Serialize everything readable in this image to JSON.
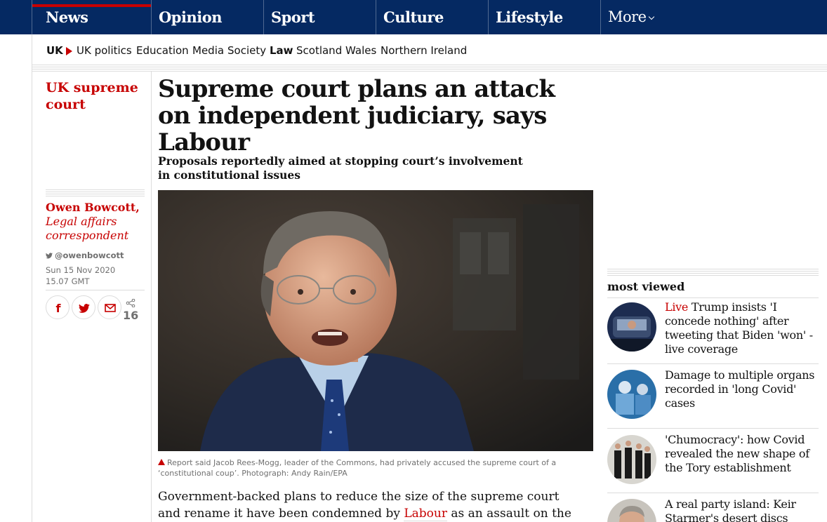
{
  "nav": {
    "pillars": [
      {
        "label": "News"
      },
      {
        "label": "Opinion"
      },
      {
        "label": "Sport"
      },
      {
        "label": "Culture"
      },
      {
        "label": "Lifestyle"
      }
    ],
    "more_label": "More"
  },
  "subnav": {
    "section": "UK",
    "items": [
      "UK politics",
      "Education",
      "Media",
      "Society",
      "Law",
      "Scotland",
      "Wales",
      "Northern Ireland"
    ],
    "active": "Law"
  },
  "series": "UK supreme court",
  "byline": {
    "name": "Owen Bowcott,",
    "role": "Legal affairs correspondent",
    "twitter": "@owenbowcott",
    "date": "Sun 15 Nov 2020",
    "time": "15.07 GMT"
  },
  "share": {
    "count": "16",
    "icons": [
      "facebook-icon",
      "twitter-icon",
      "email-icon",
      "share-icon"
    ]
  },
  "article": {
    "headline": "Supreme court plans an attack on independent judiciary, says Labour",
    "standfirst": "Proposals reportedly aimed at stopping court’s involvement in constitutional issues",
    "caption": "Report said Jacob Rees-Mogg, leader of the Commons, had privately accused the supreme court of a ‘constitutional coup’. Photograph: Andy Rain/EPA",
    "body_before": "Government-backed plans to reduce the size of the supreme court and rename it have been condemned by ",
    "body_link": "Labour",
    "body_after": " as an assault on the"
  },
  "most_viewed": {
    "title": "most viewed",
    "items": [
      {
        "kicker": "Live",
        "headline": "Trump insists 'I concede nothing' after tweeting that Biden 'won' - live coverage"
      },
      {
        "kicker": "",
        "headline": "Damage to multiple organs recorded in 'long Covid' cases"
      },
      {
        "kicker": "",
        "headline": "'Chumocracy': how Covid revealed the new shape of the Tory establishment"
      },
      {
        "kicker": "",
        "headline": "A real party island: Keir Starmer's desert discs have"
      }
    ]
  },
  "colors": {
    "brand_blue": "#052962",
    "news_red": "#c70000",
    "rule_grey": "#dcdcdc",
    "meta_grey": "#707070"
  }
}
